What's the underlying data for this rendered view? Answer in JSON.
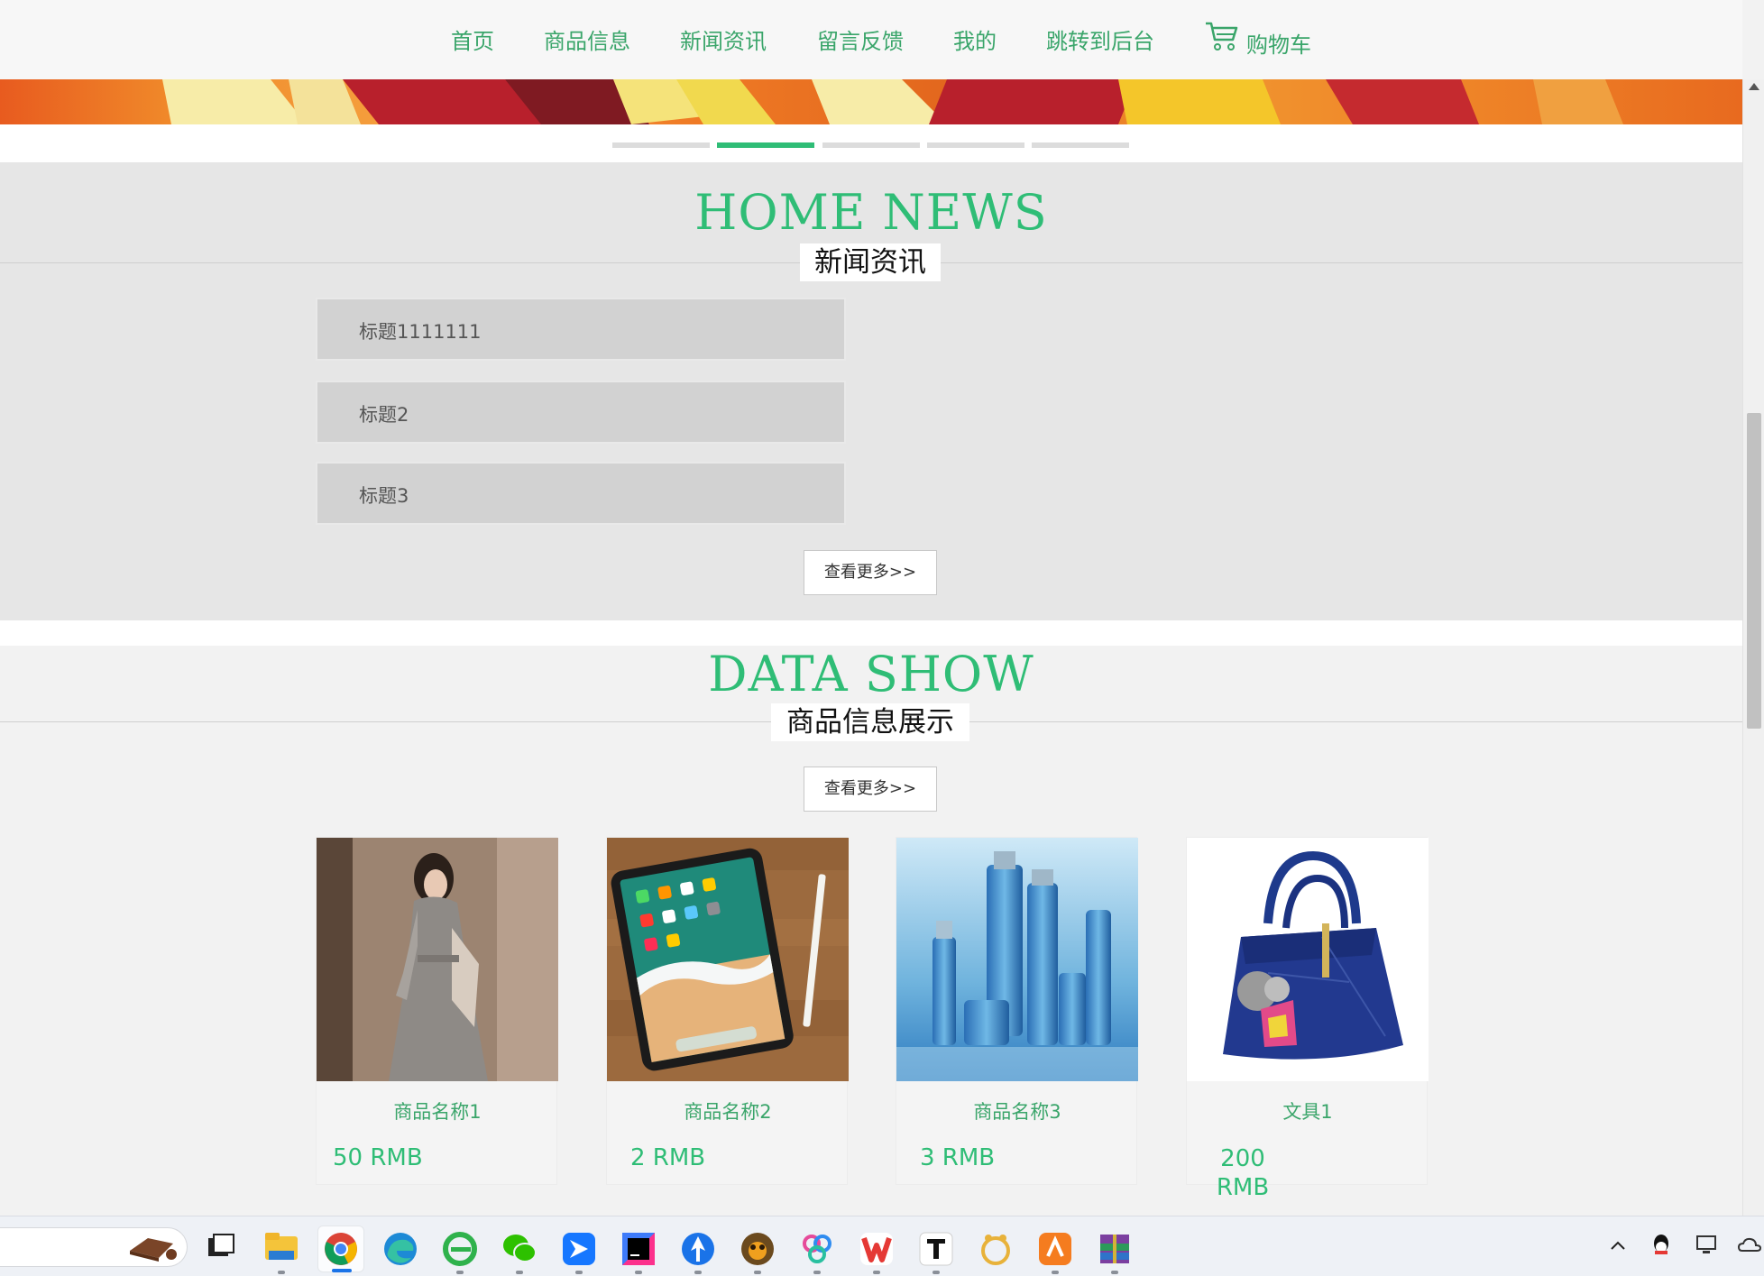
{
  "nav": {
    "items": [
      {
        "label": "首页"
      },
      {
        "label": "商品信息"
      },
      {
        "label": "新闻资讯"
      },
      {
        "label": "留言反馈"
      },
      {
        "label": "我的"
      },
      {
        "label": "跳转到后台"
      }
    ],
    "cart": {
      "label": "购物车",
      "icon": "shopping-cart-icon"
    }
  },
  "banner": {
    "slides": 5,
    "active_slide": 2
  },
  "news_section": {
    "title_en": "HOME NEWS",
    "title_cn": "新闻资讯",
    "items": [
      {
        "title": "标题1111111"
      },
      {
        "title": "标题2"
      },
      {
        "title": "标题3"
      }
    ],
    "more_label": "查看更多>>"
  },
  "data_section": {
    "title_en": "DATA SHOW",
    "title_cn": "商品信息展示",
    "more_label": "查看更多>>",
    "products": [
      {
        "name": "商品名称1",
        "price": "50 RMB",
        "image": "dress-photo"
      },
      {
        "name": "商品名称2",
        "price": "2 RMB",
        "image": "tablet-photo"
      },
      {
        "name": "商品名称3",
        "price": "3 RMB",
        "image": "cosmetics-photo"
      },
      {
        "name": "文具1",
        "price_line1": "200",
        "price_line2": "RMB",
        "image": "handbag-photo"
      }
    ]
  },
  "colors": {
    "accent": "#2fbd76",
    "nav_text": "#3aa56a",
    "news_bg": "#e6e6e6",
    "news_item_bg": "#d2d2d2"
  },
  "taskbar": {
    "apps": [
      "chocolate-app-icon",
      "task-view-icon",
      "file-explorer-icon",
      "chrome-icon",
      "edge-icon",
      "ie-icon",
      "wechat-icon",
      "feishu-icon",
      "intellij-icon",
      "browser-icon",
      "app-icon",
      "photos-icon",
      "wps-icon",
      "typora-icon",
      "paw-icon",
      "store-icon",
      "archive-icon"
    ]
  }
}
